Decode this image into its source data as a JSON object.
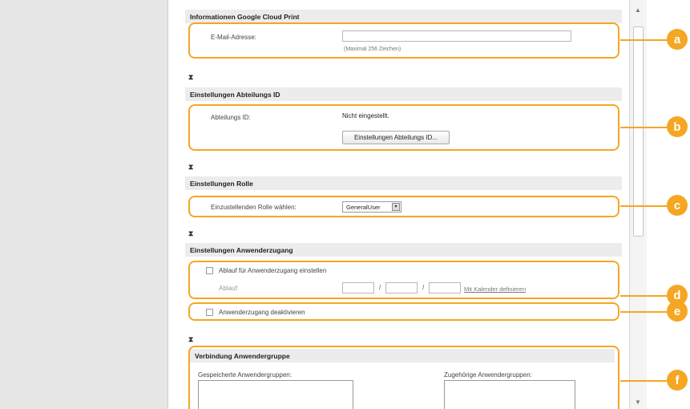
{
  "google_cloud_print": {
    "heading": "Informationen Google Cloud Print",
    "email_label": "E-Mail-Adresse:",
    "email_value": "",
    "email_hint": "(Maximal 256 Zeichen)"
  },
  "department_id": {
    "heading": "Einstellungen Abteilungs ID",
    "label": "Abteilungs ID:",
    "value": "Nicht eingestellt.",
    "button": "Einstellungen Abteilungs ID..."
  },
  "role": {
    "heading": "Einstellungen Rolle",
    "label": "Einzustellenden Rolle wählen:",
    "selected": "GeneralUser"
  },
  "user_access": {
    "heading": "Einstellungen Anwenderzugang",
    "expiry_checkbox_label": "Ablauf für Anwenderzugang einstellen",
    "expiry_checked": false,
    "expiry_label": "Ablauf:",
    "date_separator": "/",
    "calendar_link": "Mit Kalender definieren",
    "disable_checkbox_label": "Anwenderzugang deaktivieren",
    "disable_checked": false
  },
  "user_group": {
    "heading": "Verbindung Anwendergruppe",
    "saved_groups_label": "Gespeicherte Anwendergruppen:",
    "assigned_groups_label": "Zugehörige Anwendergruppen:"
  },
  "icons": {
    "collapse": "collapse-icon",
    "dropdown": "chevron-down-icon",
    "scroll_up": "scroll-up-arrow-icon",
    "scroll_down": "scroll-down-arrow-icon"
  },
  "annotations": {
    "color": "#f5a623",
    "markers": [
      "a",
      "b",
      "c",
      "d",
      "e",
      "f"
    ]
  },
  "glyphs": {
    "collapse": "⧗",
    "dropdown": "▾",
    "scroll_up": "▲",
    "scroll_down": "▼"
  }
}
